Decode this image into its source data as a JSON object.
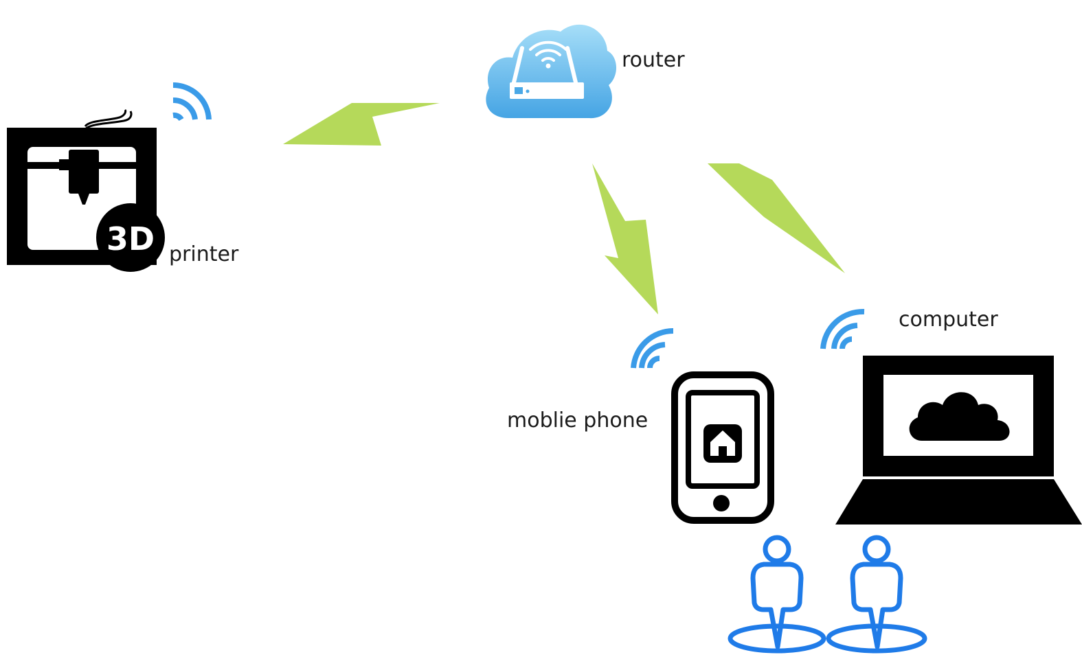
{
  "nodes": {
    "router": {
      "label": "router"
    },
    "printer": {
      "label": "printer",
      "badge": "3D"
    },
    "computer": {
      "label": "computer"
    },
    "phone": {
      "label": "moblie phone"
    }
  },
  "colors": {
    "signal": "#3a9be8",
    "bolt": "#b5d95a",
    "cloud_light": "#8ed3f5",
    "cloud_dark": "#4aa8e6",
    "device": "#000000",
    "person": "#1f7be8"
  },
  "icons": [
    "router-cloud-icon",
    "3d-printer-icon",
    "mobile-phone-icon",
    "laptop-icon",
    "wifi-signal-icon",
    "lightning-bolt-icon",
    "person-icon"
  ]
}
